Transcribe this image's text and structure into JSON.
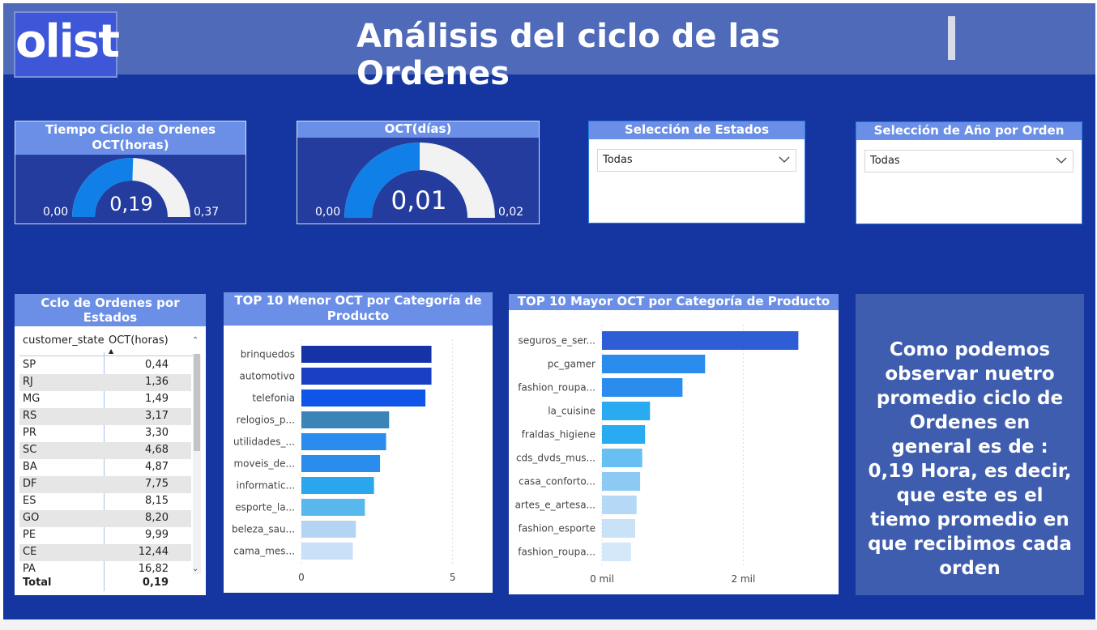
{
  "header": {
    "logo_text": "olist",
    "title": "Análisis del ciclo de las Ordenes"
  },
  "gauges": [
    {
      "title": "Tiempo Ciclo de Ordenes OCT(horas)",
      "value": "0,19",
      "min": "0,00",
      "max": "0,37",
      "fill_fraction": 0.51
    },
    {
      "title": "OCT(días)",
      "value": "0,01",
      "min": "0,00",
      "max": "0,02",
      "fill_fraction": 0.5
    }
  ],
  "slicers": [
    {
      "title": "Selección de Estados",
      "selected": "Todas"
    },
    {
      "title": "Selección de Año por Orden",
      "selected": "Todas"
    }
  ],
  "state_table": {
    "title": "Cclo de Ordenes por Estados",
    "columns": [
      "customer_state",
      "OCT(horas)"
    ],
    "rows": [
      [
        "SP",
        "0,44"
      ],
      [
        "RJ",
        "1,36"
      ],
      [
        "MG",
        "1,49"
      ],
      [
        "RS",
        "3,17"
      ],
      [
        "PR",
        "3,30"
      ],
      [
        "SC",
        "4,68"
      ],
      [
        "BA",
        "4,87"
      ],
      [
        "DF",
        "7,75"
      ],
      [
        "ES",
        "8,15"
      ],
      [
        "GO",
        "8,20"
      ],
      [
        "PE",
        "9,99"
      ],
      [
        "CE",
        "12,44"
      ],
      [
        "PA",
        "16,82"
      ]
    ],
    "total_label": "Total",
    "total_value": "0,19"
  },
  "chart_data": [
    {
      "type": "bar",
      "orientation": "horizontal",
      "title": "TOP 10 Menor OCT por Categoría de Producto",
      "categories": [
        "brinquedos",
        "automotivo",
        "telefonia",
        "relogios_p...",
        "utilidades_...",
        "moveis_de...",
        "informatic...",
        "esporte_la...",
        "beleza_sau...",
        "cama_mes..."
      ],
      "values": [
        4.3,
        4.3,
        4.1,
        2.9,
        2.8,
        2.6,
        2.4,
        2.1,
        1.8,
        1.7
      ],
      "xlim": [
        0,
        6
      ],
      "xticks": [
        "0",
        "5"
      ],
      "xtick_values": [
        0,
        5
      ],
      "grid": true,
      "colors": [
        "#1532a6",
        "#1a3fc4",
        "#0f55e8",
        "#3a84b8",
        "#2a8cec",
        "#2a8cec",
        "#2aa6ec",
        "#58b8ee",
        "#b4d4f4",
        "#c8e0f8"
      ]
    },
    {
      "type": "bar",
      "orientation": "horizontal",
      "title": "TOP 10 Mayor OCT por Categoría de Producto",
      "categories": [
        "seguros_e_ser...",
        "pc_gamer",
        "fashion_roupa...",
        "la_cuisine",
        "fraldas_higiene",
        "cds_dvds_mus...",
        "casa_conforto...",
        "artes_e_artesa...",
        "fashion_esporte",
        "fashion_roupa..."
      ],
      "values": [
        2780,
        1460,
        1140,
        680,
        610,
        570,
        540,
        490,
        470,
        410
      ],
      "xlim": [
        0,
        3200
      ],
      "xticks": [
        "0 mil",
        "2 mil"
      ],
      "xtick_values": [
        0,
        2000
      ],
      "grid": true,
      "colors": [
        "#2d5ed6",
        "#2a8cec",
        "#2a8cec",
        "#2aaaf0",
        "#2aaaf0",
        "#68bff2",
        "#8ccaf4",
        "#b4d8f6",
        "#c8e2f8",
        "#d4e8fa"
      ]
    }
  ],
  "note": {
    "text": "Como podemos observar nuetro promedio ciclo de Ordenes en general es de : 0,19 Hora, es decir, que este es el tiemo promedio en que recibimos cada orden"
  }
}
